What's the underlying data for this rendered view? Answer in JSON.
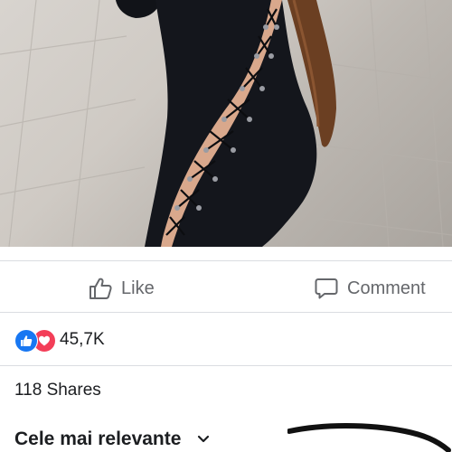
{
  "post": {
    "actions": {
      "like_label": "Like",
      "comment_label": "Comment"
    },
    "reactions": {
      "count": "45,7K",
      "types": [
        "like-icon",
        "love-icon"
      ]
    },
    "shares": "118 Shares"
  },
  "comments": {
    "sort_label": "Cele mai relevante"
  },
  "colors": {
    "like_blue": "#1877f2",
    "love_red": "#f33e58",
    "muted_text": "#65676b",
    "divider": "#dadde1"
  }
}
